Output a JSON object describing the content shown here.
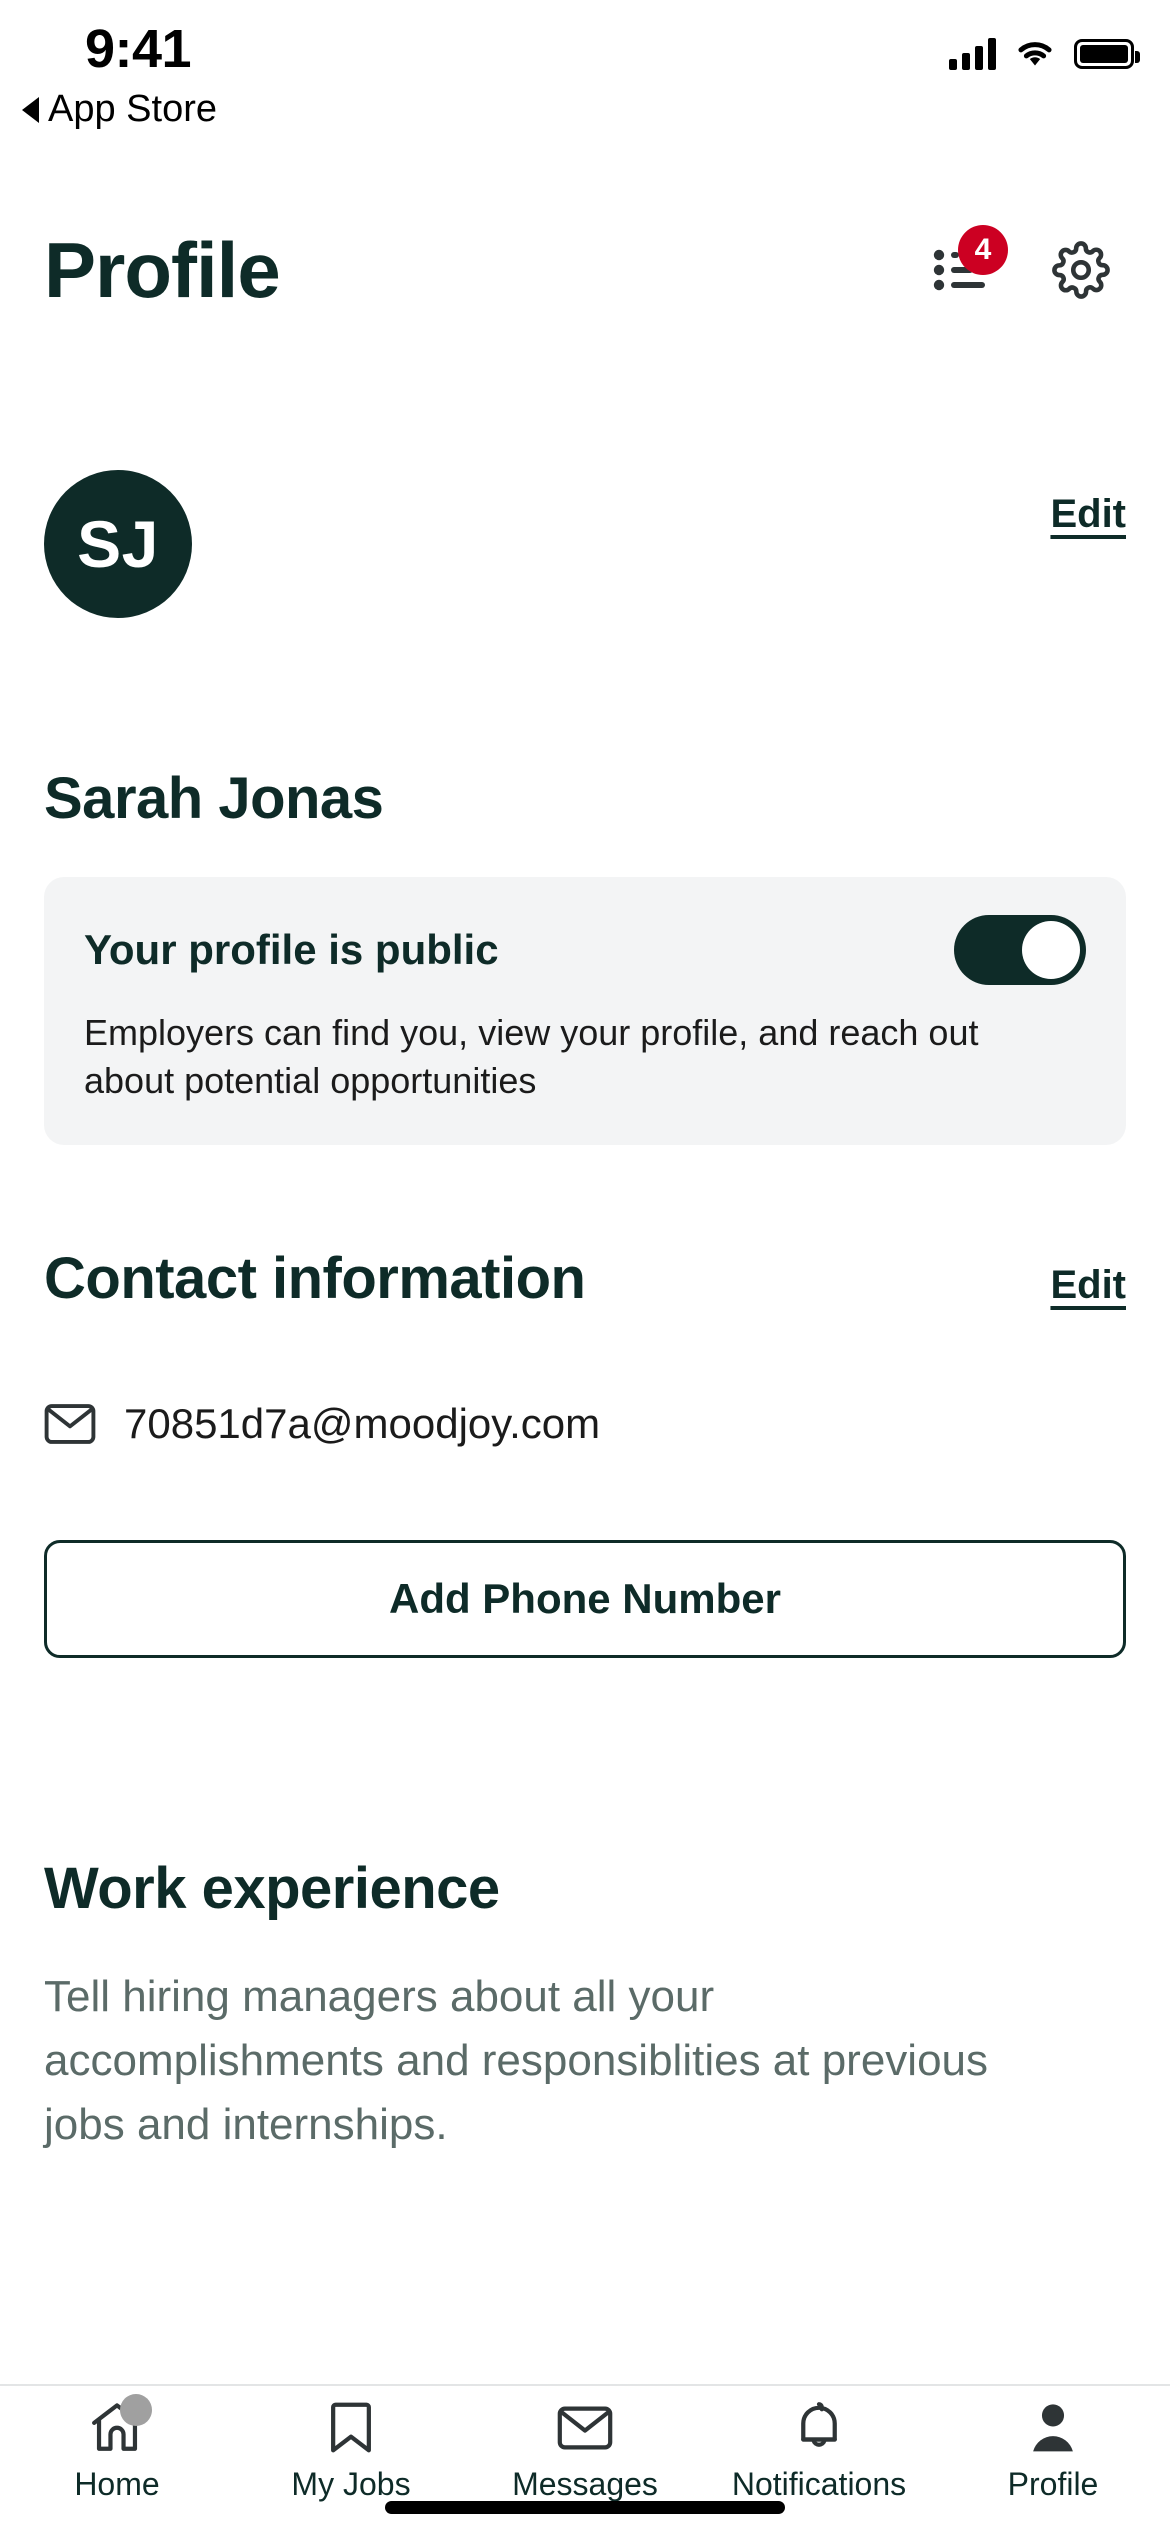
{
  "status_bar": {
    "time": "9:41",
    "back_label": "App Store",
    "icons": {
      "back_caret": "triangle-left-icon",
      "signal": "signal-bars-icon",
      "wifi": "wifi-icon",
      "battery": "battery-full-icon"
    }
  },
  "header": {
    "title": "Profile",
    "notifications_icon": "list-lines-icon",
    "notifications_badge": "4",
    "settings_icon": "gear-icon",
    "badge_color": "#CC0022"
  },
  "profile": {
    "avatar_initials": "SJ",
    "avatar_color": "#0E2B28",
    "edit_label": "Edit",
    "name": "Sarah Jonas"
  },
  "public_card": {
    "title": "Your profile is public",
    "description": "Employers can find you, view your profile, and reach out about potential opportunities",
    "toggle_state": "on",
    "toggle_color": "#0E2B28",
    "background": "#F3F4F5"
  },
  "contact": {
    "section_title": "Contact information",
    "edit_label": "Edit",
    "email_icon": "envelope-icon",
    "email": "70851d7a@moodjoy.com",
    "add_phone_label": "Add Phone Number"
  },
  "work": {
    "section_title": "Work experience",
    "description": "Tell hiring managers about all your accomplishments and responsiblities at previous jobs and internships."
  },
  "tabbar": {
    "items": [
      {
        "label": "Home",
        "icon": "home-icon",
        "active": false,
        "badge": "dot"
      },
      {
        "label": "My Jobs",
        "icon": "bookmark-icon",
        "active": false,
        "badge": ""
      },
      {
        "label": "Messages",
        "icon": "envelope-icon",
        "active": false,
        "badge": ""
      },
      {
        "label": "Notifications",
        "icon": "bell-icon",
        "active": false,
        "badge": ""
      },
      {
        "label": "Profile",
        "icon": "person-filled-icon",
        "active": true,
        "badge": ""
      }
    ]
  },
  "theme": {
    "primary": "#0E2B28",
    "text_muted": "#5B6B68",
    "icon_dark": "#2E3436"
  }
}
